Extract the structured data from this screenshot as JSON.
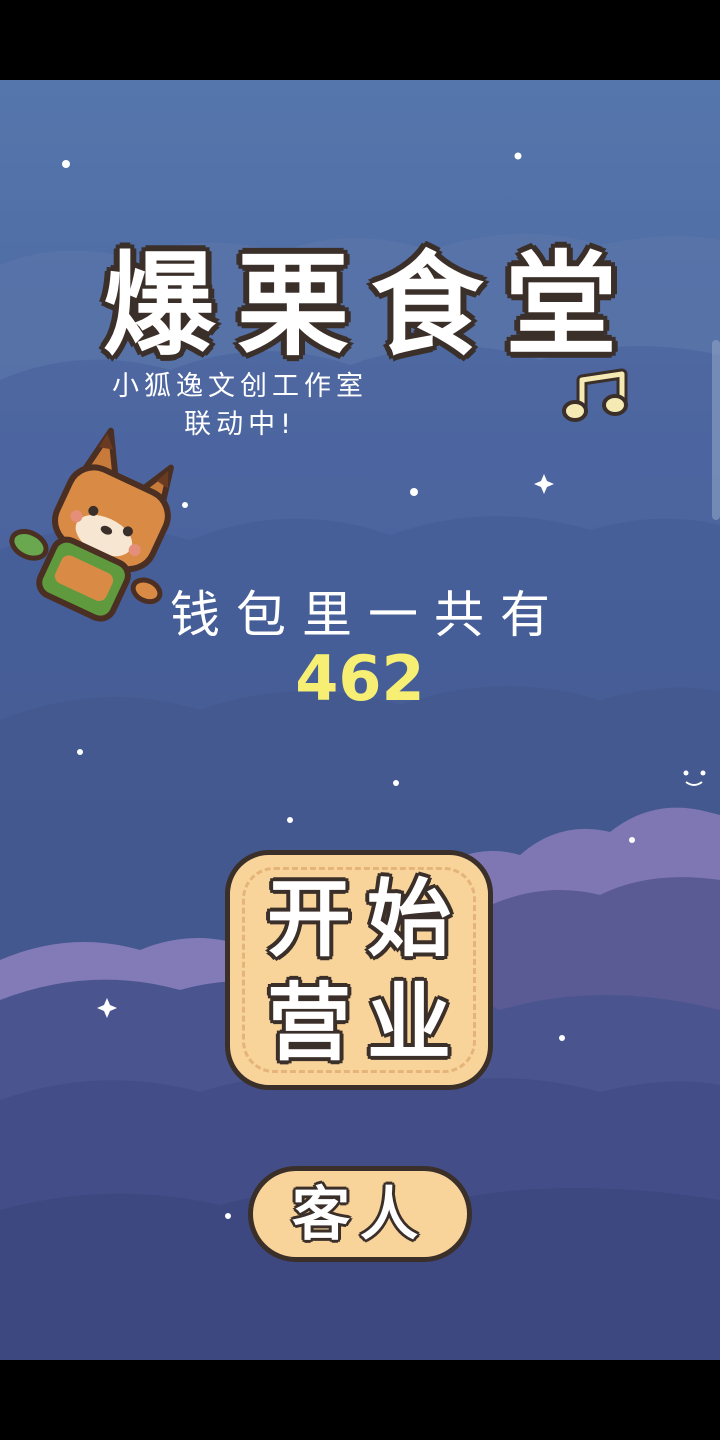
{
  "game": {
    "title": "爆栗食堂",
    "collab_line1": "小狐逸文创工作室",
    "collab_line2": "联动中!",
    "wallet_label": "钱包里一共有",
    "wallet_amount": "462",
    "start_button": {
      "line1": "开始",
      "line2": "营业"
    },
    "guest_button": "客人"
  },
  "icons": {
    "music": "music-note-icon",
    "mascot": "fox-mascot"
  },
  "colors": {
    "sky_top": "#5576ac",
    "sky_bottom": "#3b4b80",
    "button_fill": "#f9d49a",
    "outline": "#3b2f2a",
    "amount": "#f6ef74",
    "cloud_purple": "#7e77b3"
  }
}
